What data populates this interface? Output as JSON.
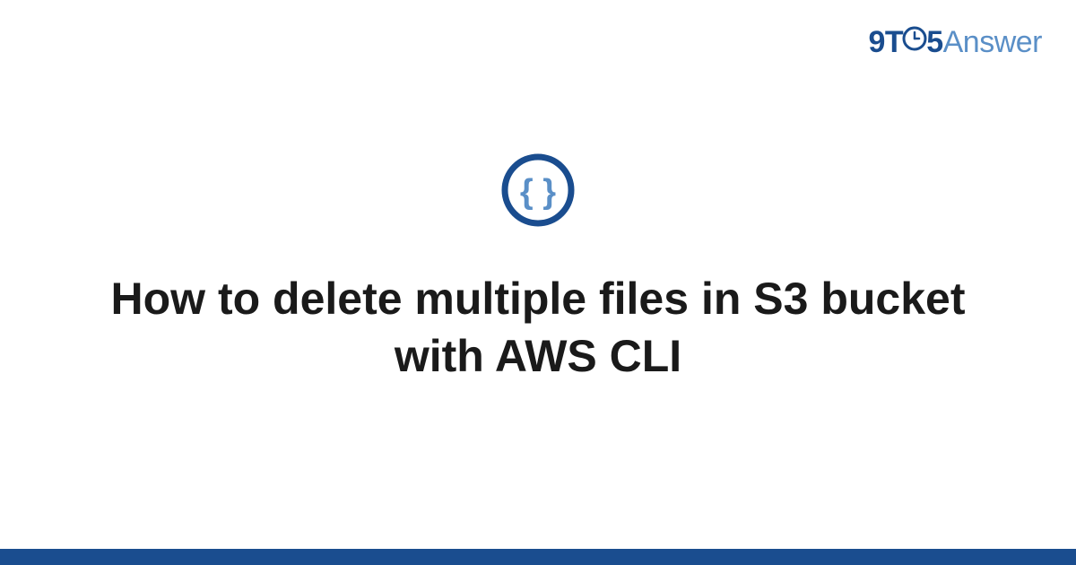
{
  "brand": {
    "part1": "9",
    "part2": "T",
    "part3": "5",
    "part4": "Answer"
  },
  "main": {
    "title": "How to delete multiple files in S3 bucket with AWS CLI"
  },
  "colors": {
    "brand_dark": "#1a4d8f",
    "brand_light": "#5a8fc7",
    "footer": "#1a4d8f"
  }
}
